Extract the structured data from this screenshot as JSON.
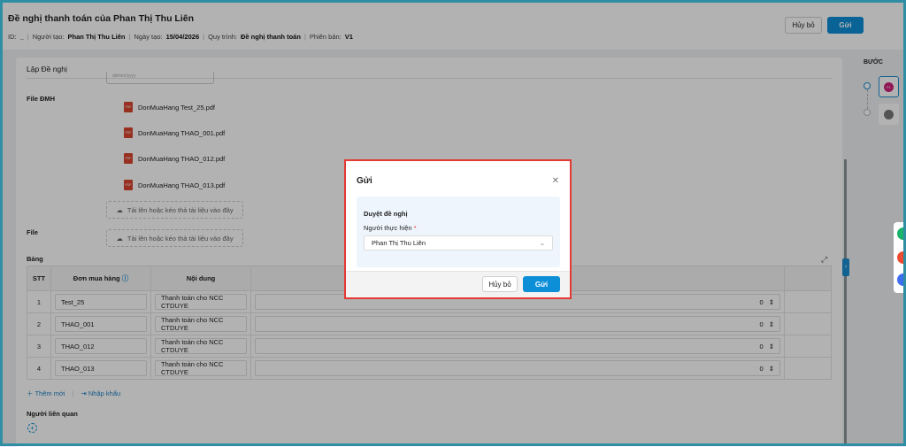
{
  "header": {
    "title": "Đề nghị thanh toán của Phan Thị Thu Liên",
    "meta": {
      "id_label": "ID:",
      "id_value": "_",
      "creator_label": "Người tạo:",
      "creator_value": "Phan Thị Thu Liên",
      "date_label": "Ngày tạo:",
      "date_value": "15/04/2026",
      "process_label": "Quy trình:",
      "process_value": "Đề nghị thanh toán",
      "version_label": "Phiên bản:",
      "version_value": "V1"
    },
    "cancel_label": "Hủy bỏ",
    "send_label": "Gửi"
  },
  "form": {
    "section_title": "Lập Đề nghị",
    "date_placeholder": "dd/mm/yyyy",
    "file_dmh_label": "File ĐMH",
    "files": [
      "DonMuaHang Test_25.pdf",
      "DonMuaHang THAO_001.pdf",
      "DonMuaHang THAO_012.pdf",
      "DonMuaHang THAO_013.pdf"
    ],
    "upload_label": "Tải lên hoặc kéo thả tài liệu vào đây",
    "file_label": "File",
    "table_label": "Bảng",
    "table": {
      "headers": [
        "STT",
        "Đơn mua hàng",
        "Nội dung"
      ],
      "rows": [
        {
          "stt": "1",
          "order": "Test_25",
          "content": "Thanh toán cho NCC CTDUYE",
          "amount": "0"
        },
        {
          "stt": "2",
          "order": "THAO_001",
          "content": "Thanh toán cho NCC CTDUYE",
          "amount": "0"
        },
        {
          "stt": "3",
          "order": "THAO_012",
          "content": "Thanh toán cho NCC CTDUYE",
          "amount": "0"
        },
        {
          "stt": "4",
          "order": "THAO_013",
          "content": "Thanh toán cho NCC CTDUYE",
          "amount": "0"
        }
      ]
    },
    "add_label": "Thêm mới",
    "import_label": "Nhập khẩu",
    "related_label": "Người liên quan"
  },
  "steps": {
    "title": "BƯỚC",
    "avatar_initials": "PL"
  },
  "modal": {
    "title": "Gửi",
    "section": "Duyệt đề nghị",
    "field_label": "Người thực hiện",
    "required_mark": "*",
    "field_value": "Phan Thị Thu Liên",
    "cancel_label": "Hủy bỏ",
    "send_label": "Gửi"
  },
  "colors": {
    "primary": "#0d8fd8",
    "highlight": "#e53935",
    "frame": "#2f8ea3"
  }
}
